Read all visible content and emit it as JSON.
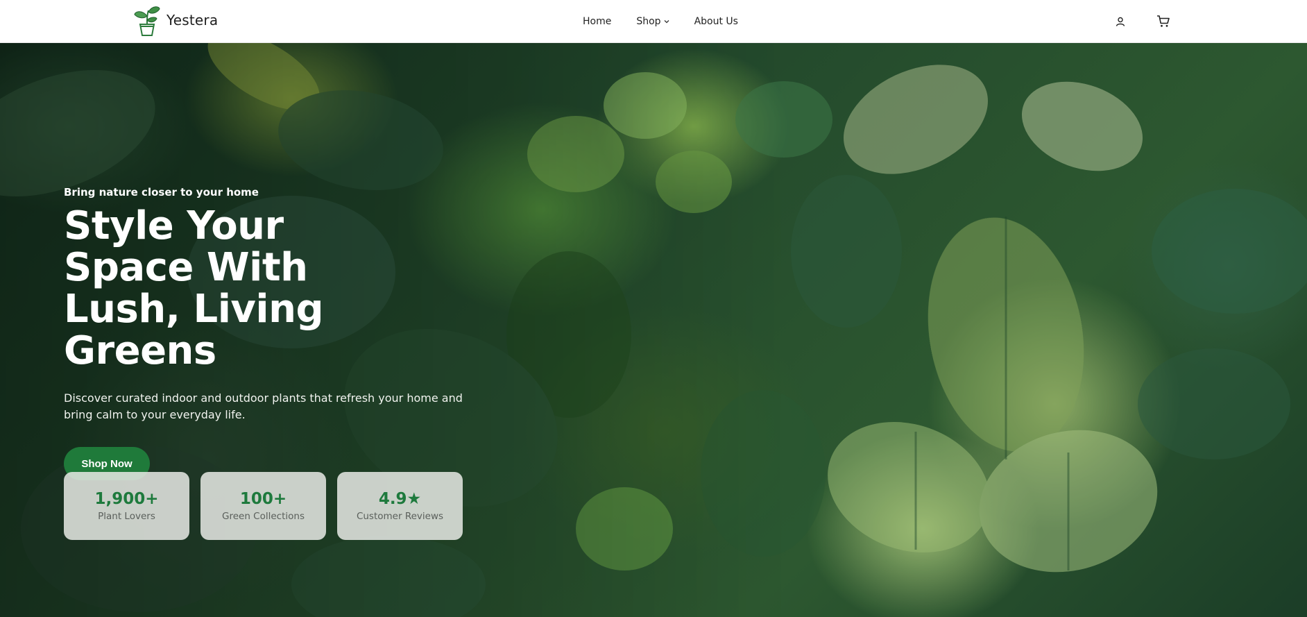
{
  "brand": {
    "name": "Yestera"
  },
  "nav": {
    "items": [
      {
        "label": "Home"
      },
      {
        "label": "Shop"
      },
      {
        "label": "About Us"
      }
    ]
  },
  "header_actions": {
    "icons": [
      "user-icon",
      "cart-icon"
    ]
  },
  "hero": {
    "eyebrow": "Bring nature closer to your home",
    "headline": "Style Your Space With Lush, Living Greens",
    "description": "Discover curated indoor and outdoor plants that refresh your home and bring calm to your everyday life.",
    "cta": "Shop Now"
  },
  "stats": [
    {
      "value": "1,900+",
      "label": "Plant Lovers"
    },
    {
      "value": "100+",
      "label": "Green Collections"
    },
    {
      "value": "4.9★",
      "label": "Customer Reviews"
    }
  ],
  "colors": {
    "accent": "#1f7a3a",
    "stat_value": "#1e7a3d",
    "header_bg": "#ffffff"
  }
}
